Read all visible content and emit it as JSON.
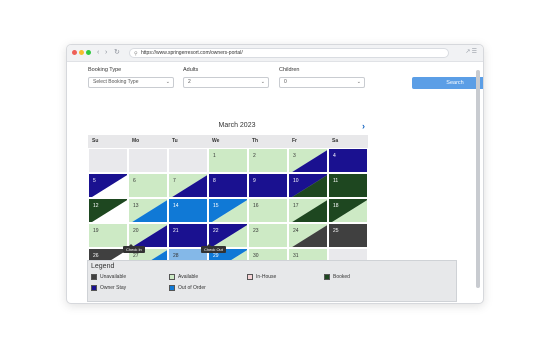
{
  "browser": {
    "url": "https://www.springerresort.com/owners-portal/"
  },
  "form": {
    "booking_type": {
      "label": "Booking Type",
      "value": "Select Booking Type"
    },
    "adults": {
      "label": "Adults",
      "value": "2"
    },
    "children": {
      "label": "Children",
      "value": "0"
    },
    "search_label": "Search"
  },
  "calendar": {
    "month": "March 2023",
    "day_headers": [
      "Su",
      "Mo",
      "Tu",
      "We",
      "Th",
      "Fr",
      "Sa"
    ],
    "colors": {
      "available": "#cdeac5",
      "owner": "#1a1190",
      "booked": "#1e4720",
      "ooo": "#1079d6",
      "unavailable": "#404040",
      "white": "#ffffff",
      "grey": "#e9e9ec",
      "selected": "#84b8e8"
    },
    "cells": [
      {
        "day": "",
        "type": "grey"
      },
      {
        "day": "",
        "type": "grey"
      },
      {
        "day": "",
        "type": "grey"
      },
      {
        "day": "1",
        "type": "available"
      },
      {
        "day": "2",
        "type": "available"
      },
      {
        "day": "3",
        "am": "available",
        "pm": "owner"
      },
      {
        "day": "4",
        "type": "owner"
      },
      {
        "day": "5",
        "am": "owner",
        "pm": "white"
      },
      {
        "day": "6",
        "type": "available"
      },
      {
        "day": "7",
        "am": "available",
        "pm": "owner"
      },
      {
        "day": "8",
        "type": "owner"
      },
      {
        "day": "9",
        "type": "owner"
      },
      {
        "day": "10",
        "am": "owner",
        "pm": "booked"
      },
      {
        "day": "11",
        "type": "booked"
      },
      {
        "day": "12",
        "am": "booked",
        "pm": "white"
      },
      {
        "day": "13",
        "am": "available",
        "pm": "ooo"
      },
      {
        "day": "14",
        "type": "ooo"
      },
      {
        "day": "15",
        "am": "ooo",
        "pm": "available"
      },
      {
        "day": "16",
        "type": "available"
      },
      {
        "day": "17",
        "am": "available",
        "pm": "booked"
      },
      {
        "day": "18",
        "am": "booked",
        "pm": "available"
      },
      {
        "day": "19",
        "type": "available"
      },
      {
        "day": "20",
        "am": "available",
        "pm": "owner"
      },
      {
        "day": "21",
        "type": "owner"
      },
      {
        "day": "22",
        "am": "owner",
        "pm": "available"
      },
      {
        "day": "23",
        "type": "available"
      },
      {
        "day": "24",
        "am": "available",
        "pm": "unavailable"
      },
      {
        "day": "25",
        "type": "unavailable"
      },
      {
        "day": "26",
        "am": "unavailable",
        "pm": "white"
      },
      {
        "day": "27",
        "am": "available",
        "pm": "ooo"
      },
      {
        "day": "28",
        "type": "selected"
      },
      {
        "day": "29",
        "am": "ooo",
        "pm": "available"
      },
      {
        "day": "30",
        "type": "available"
      },
      {
        "day": "31",
        "type": "available"
      },
      {
        "day": "",
        "type": "grey"
      }
    ],
    "tooltips": {
      "checkin": "Check In",
      "checkout": "Check Out"
    }
  },
  "legend": {
    "title": "Legend",
    "items": [
      {
        "label": "Unavailable",
        "color": "#404040"
      },
      {
        "label": "Available",
        "color": "#cdeac5"
      },
      {
        "label": "In-House",
        "color": "#f6d3d6"
      },
      {
        "label": "Booked",
        "color": "#1e4720"
      },
      {
        "label": "Owner Stay",
        "color": "#1a1190"
      },
      {
        "label": "Out of Order",
        "color": "#1079d6"
      }
    ]
  }
}
